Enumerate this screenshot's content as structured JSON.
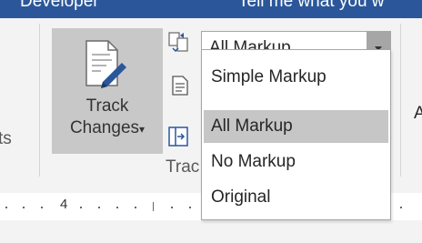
{
  "titlebar": {
    "left_fragment": "Developer",
    "right_fragment": "Tell me what you w"
  },
  "ribbon": {
    "prev_group_fragment": "ts",
    "track_changes": {
      "line1": "Track",
      "line2": "Changes",
      "arrow": "▾"
    },
    "group_label_fragment": "Trac",
    "right_edge_fragment": "A",
    "markup_combo": {
      "value": "All Markup"
    },
    "markup_options": [
      "Simple Markup",
      "All Markup",
      "No Markup",
      "Original"
    ],
    "selected_option": "All Markup"
  },
  "ruler": {
    "label": "4"
  },
  "icons": {
    "track_changes": "track-changes-pencil-icon",
    "display_for_review": "display-for-review-icon",
    "show_markup": "show-markup-icon",
    "reviewing_pane": "reviewing-pane-icon"
  },
  "colors": {
    "titlebar": "#2b579a",
    "ribbon": "#f3f3f3",
    "button_pressed": "#c8c8c8",
    "option_selected": "#c6c6c6",
    "pencil": "#2b579a"
  }
}
